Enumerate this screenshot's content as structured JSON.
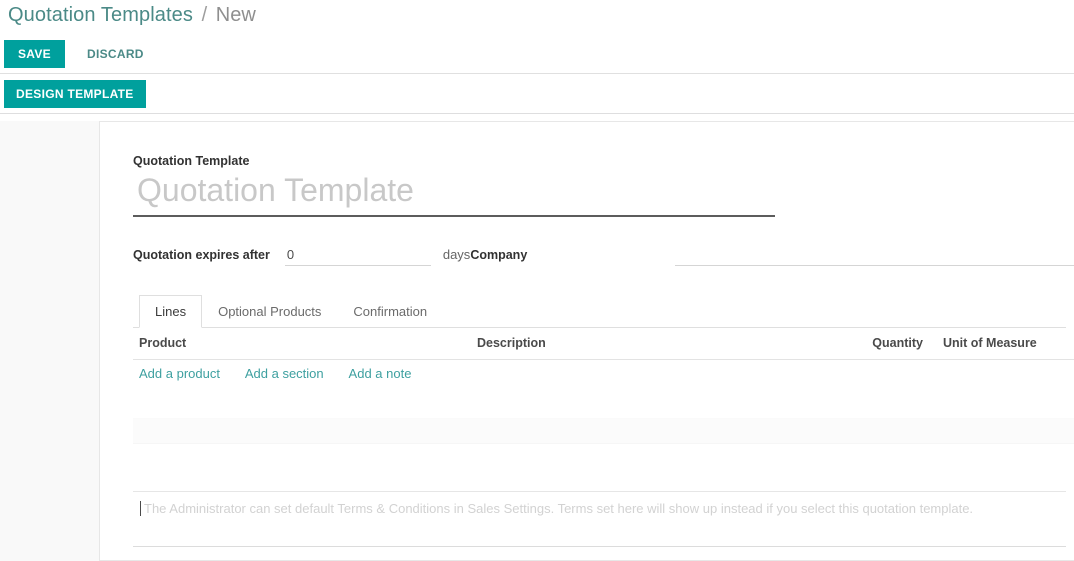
{
  "breadcrumb": {
    "root": "Quotation Templates",
    "separator": "/",
    "current": "New"
  },
  "actions": {
    "save_label": "SAVE",
    "discard_label": "DISCARD"
  },
  "statusbar": {
    "design_template_label": "DESIGN TEMPLATE"
  },
  "form": {
    "title_label": "Quotation Template",
    "title_value": "",
    "title_placeholder": "Quotation Template",
    "expires_label": "Quotation expires after",
    "expires_value": "0",
    "expires_suffix": "days",
    "company_label": "Company",
    "company_value": "",
    "company_placeholder": ""
  },
  "notebook": {
    "tabs": [
      {
        "label": "Lines",
        "active": true
      },
      {
        "label": "Optional Products",
        "active": false
      },
      {
        "label": "Confirmation",
        "active": false
      }
    ]
  },
  "lines": {
    "columns": {
      "product": "Product",
      "description": "Description",
      "quantity": "Quantity",
      "uom": "Unit of Measure"
    },
    "rows": [],
    "links": {
      "add_product": "Add a product",
      "add_section": "Add a section",
      "add_note": "Add a note"
    }
  },
  "terms": {
    "value": "",
    "placeholder": "The Administrator can set default Terms & Conditions in Sales Settings. Terms set here will show up instead if you select this quotation template."
  },
  "colors": {
    "accent": "#00a09d",
    "link": "#3ea0a0",
    "breadcrumb_link": "#4b8a87",
    "muted_text": "#8f8f8f",
    "placeholder": "#c8c8c8"
  }
}
